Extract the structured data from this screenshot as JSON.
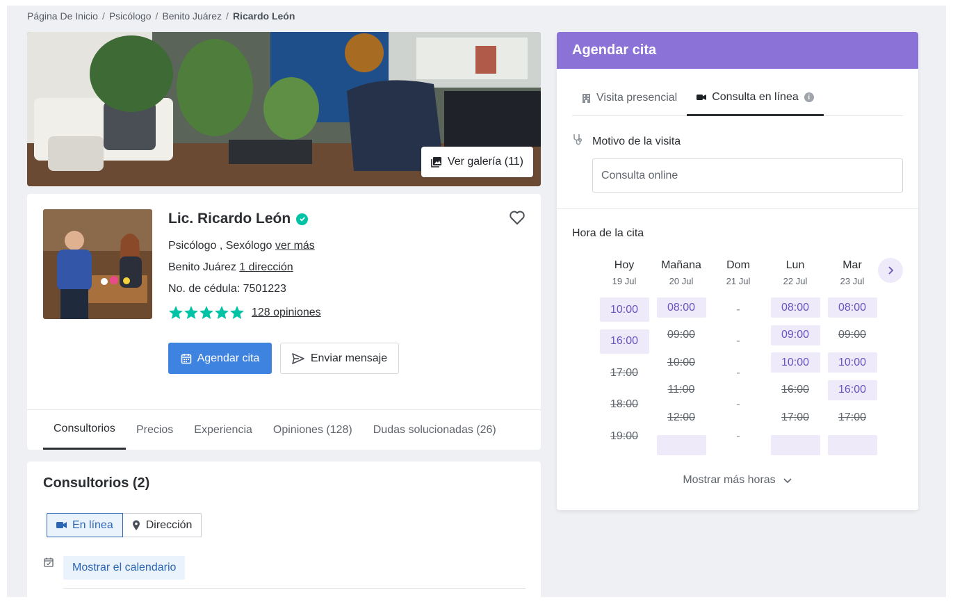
{
  "breadcrumb": [
    "Página De Inicio",
    "Psicólogo",
    "Benito Juárez",
    "Ricardo León"
  ],
  "gallery": {
    "label": "Ver galería (11)"
  },
  "profile": {
    "name": "Lic. Ricardo León",
    "specialties": "Psicólogo , Sexólogo",
    "see_more": "ver más",
    "location": "Benito Juárez",
    "addresses_link": "1 dirección",
    "license": "No. de cédula: 7501223",
    "rating": 5,
    "reviews_link": "128 opiniones",
    "book_button": "Agendar cita",
    "message_button": "Enviar mensaje"
  },
  "profile_tabs": [
    "Consultorios",
    "Precios",
    "Experiencia",
    "Opiniones (128)",
    "Dudas solucionadas (26)"
  ],
  "offices": {
    "title": "Consultorios (2)",
    "online_btn": "En línea",
    "address_btn": "Dirección",
    "show_calendar": "Mostrar el calendario"
  },
  "booking": {
    "title": "Agendar cita",
    "tab_in_person": "Visita presencial",
    "tab_online": "Consulta en línea",
    "reason_label": "Motivo de la visita",
    "reason_value": "Consulta online",
    "time_label": "Hora de la cita",
    "show_more": "Mostrar más horas",
    "days": [
      {
        "name": "Hoy",
        "date": "19 Jul"
      },
      {
        "name": "Mañana",
        "date": "20 Jul"
      },
      {
        "name": "Dom",
        "date": "21 Jul"
      },
      {
        "name": "Lun",
        "date": "22 Jul"
      },
      {
        "name": "Mar",
        "date": "23 Jul"
      }
    ],
    "slots": [
      [
        {
          "t": "10:00",
          "s": "free"
        },
        {
          "t": "16:00",
          "s": "free"
        },
        {
          "t": "17:00",
          "s": "taken"
        },
        {
          "t": "18:00",
          "s": "taken"
        },
        {
          "t": "19:00",
          "s": "taken"
        }
      ],
      [
        {
          "t": "08:00",
          "s": "free"
        },
        {
          "t": "09:00",
          "s": "taken"
        },
        {
          "t": "10:00",
          "s": "taken"
        },
        {
          "t": "11:00",
          "s": "taken"
        },
        {
          "t": "12:00",
          "s": "taken"
        },
        {
          "t": "",
          "s": "free"
        }
      ],
      [
        {
          "t": "-",
          "s": "none"
        },
        {
          "t": "-",
          "s": "none"
        },
        {
          "t": "-",
          "s": "none"
        },
        {
          "t": "-",
          "s": "none"
        },
        {
          "t": "-",
          "s": "none"
        }
      ],
      [
        {
          "t": "08:00",
          "s": "free"
        },
        {
          "t": "09:00",
          "s": "free"
        },
        {
          "t": "10:00",
          "s": "free"
        },
        {
          "t": "16:00",
          "s": "taken"
        },
        {
          "t": "17:00",
          "s": "taken"
        },
        {
          "t": "",
          "s": "free"
        }
      ],
      [
        {
          "t": "08:00",
          "s": "free"
        },
        {
          "t": "09:00",
          "s": "taken"
        },
        {
          "t": "10:00",
          "s": "free"
        },
        {
          "t": "16:00",
          "s": "free"
        },
        {
          "t": "17:00",
          "s": "taken"
        },
        {
          "t": "",
          "s": "free"
        }
      ]
    ]
  },
  "colors": {
    "accent": "#8b72d6",
    "primary": "#3f83e0",
    "star": "#00c3a5"
  }
}
